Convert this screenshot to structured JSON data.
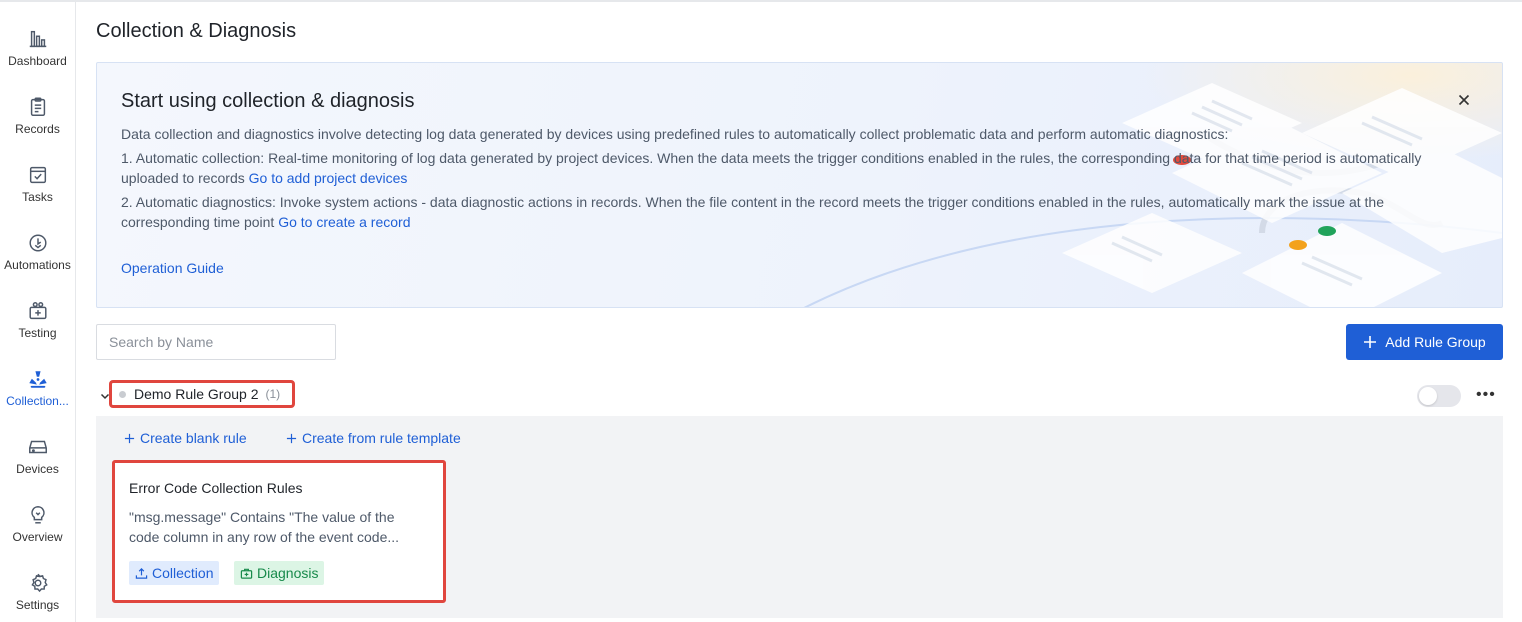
{
  "sidebar": {
    "items": [
      {
        "label": "Dashboard",
        "icon": "bar-chart-icon"
      },
      {
        "label": "Records",
        "icon": "clipboard-icon"
      },
      {
        "label": "Tasks",
        "icon": "task-check-icon"
      },
      {
        "label": "Automations",
        "icon": "automation-icon"
      },
      {
        "label": "Testing",
        "icon": "testing-kit-icon"
      },
      {
        "label": "Collection...",
        "icon": "radiation-icon",
        "active": true
      },
      {
        "label": "Devices",
        "icon": "device-icon"
      },
      {
        "label": "Overview",
        "icon": "lightbulb-icon"
      },
      {
        "label": "Settings",
        "icon": "gear-icon"
      }
    ]
  },
  "page": {
    "title": "Collection & Diagnosis"
  },
  "banner": {
    "title": "Start using collection & diagnosis",
    "intro": "Data collection and diagnostics involve detecting log data generated by devices using predefined rules to automatically collect problematic data and perform automatic diagnostics:",
    "item1_text": "1. Automatic collection: Real-time monitoring of log data generated by project devices. When the data meets the trigger conditions enabled in the rules, the corresponding data for that time period is automatically uploaded to records ",
    "item1_link": "Go to add project devices",
    "item2_text": "2. Automatic diagnostics: Invoke system actions - data diagnostic actions in records. When the file content in the record meets the trigger conditions enabled in the rules, automatically mark the issue at the corresponding time point ",
    "item2_link": "Go to create a record",
    "guide_link": "Operation Guide"
  },
  "toolbar": {
    "search_placeholder": "Search by Name",
    "add_button": "Add Rule Group"
  },
  "group": {
    "name": "Demo Rule Group 2",
    "count": "(1)",
    "enabled": false,
    "actions": {
      "create_blank": "Create blank rule",
      "create_template": "Create from rule template"
    },
    "rules": [
      {
        "title": "Error Code Collection Rules",
        "description": "\"msg.message\" Contains \"The value of the code column in any row of the event code...",
        "tags": {
          "collection": "Collection",
          "diagnosis": "Diagnosis"
        }
      }
    ]
  },
  "colors": {
    "accent": "#1f5fd6",
    "highlight": "#e0463e",
    "tag_green": "#188a4b"
  }
}
